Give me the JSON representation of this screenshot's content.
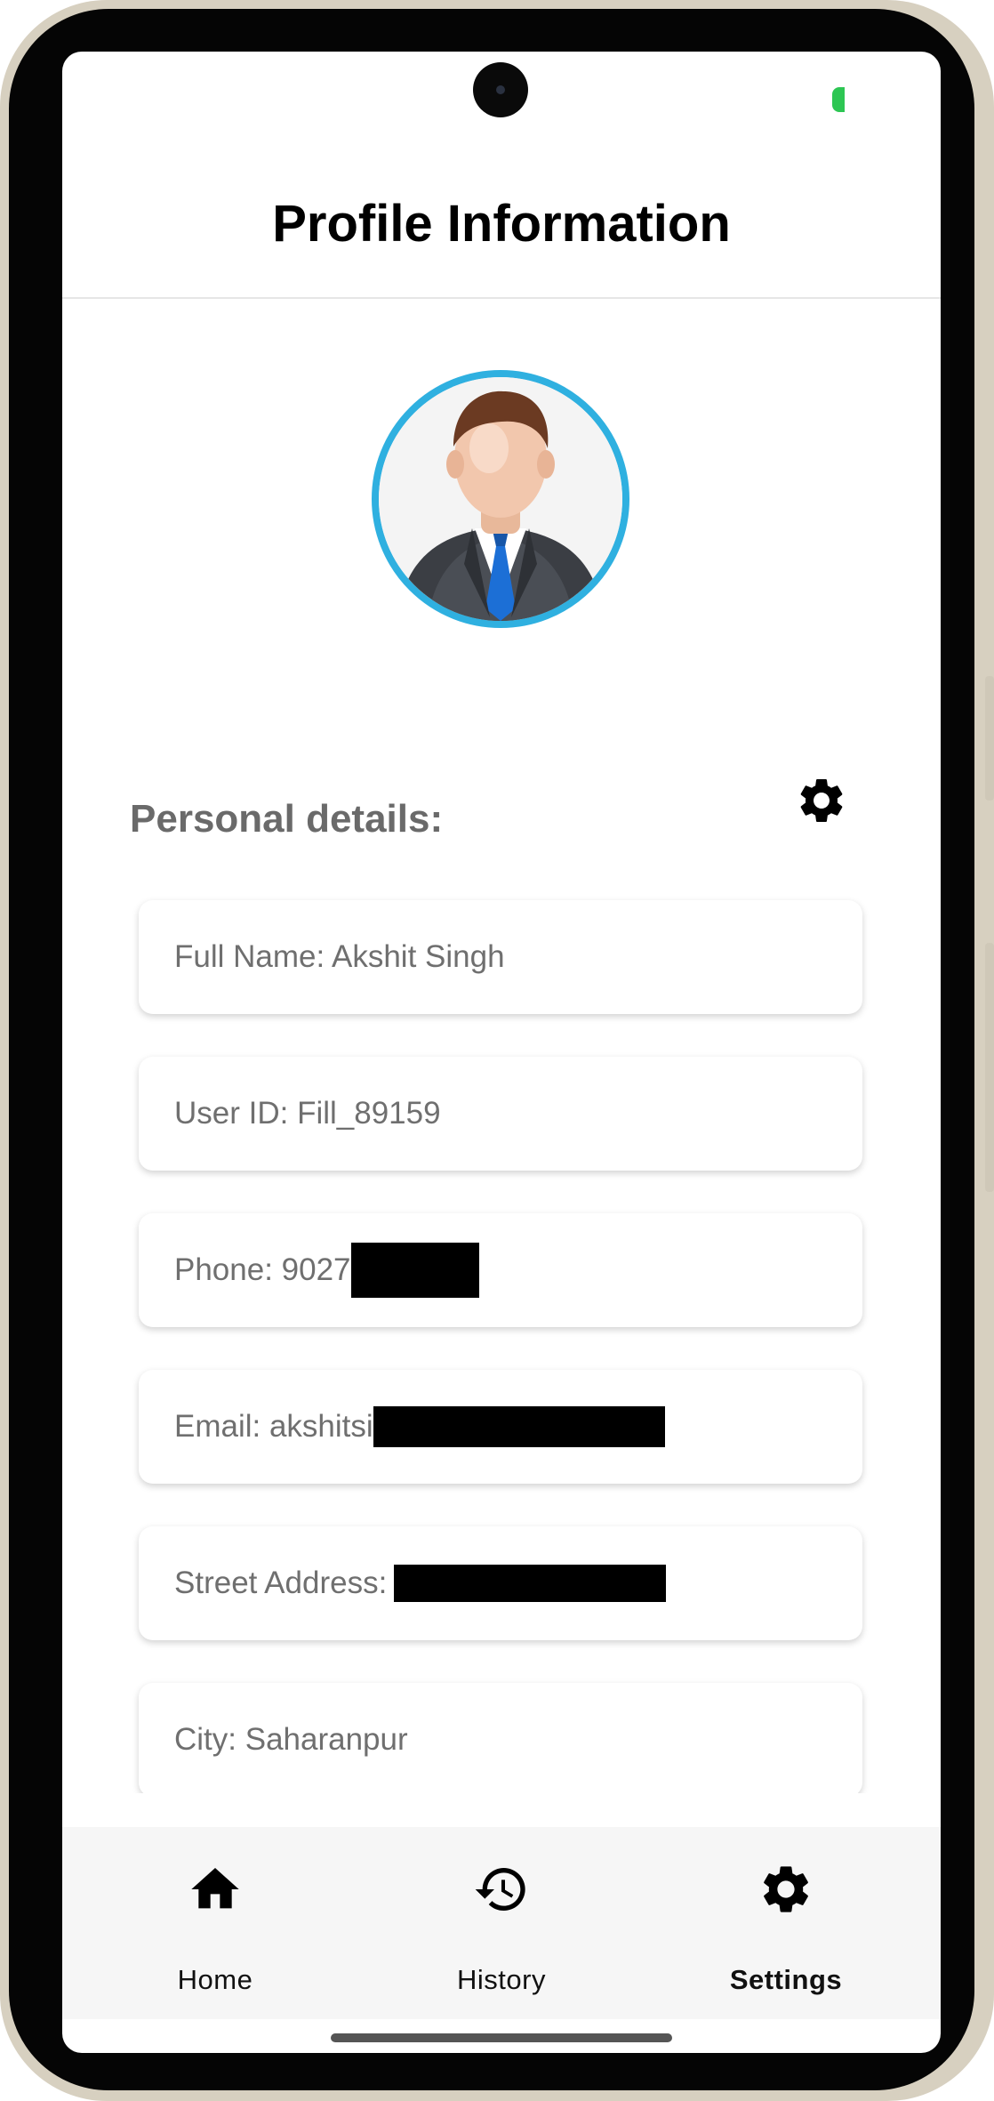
{
  "header": {
    "title": "Profile Information"
  },
  "profile": {
    "avatar_icon": "businessman-avatar-icon"
  },
  "section": {
    "title": "Personal details:",
    "settings_icon": "gear-icon"
  },
  "details": [
    {
      "text": "Full Name: Akshit Singh",
      "redacted": false
    },
    {
      "text": "User ID: Fill_89159",
      "redacted": false
    },
    {
      "text": "Phone: 9027",
      "redacted": true
    },
    {
      "text": "Email: akshitsi",
      "redacted": true
    },
    {
      "text": "Street Address: ",
      "redacted": true
    },
    {
      "text": "City: Saharanpur",
      "redacted": false
    }
  ],
  "nav": {
    "items": [
      {
        "label": "Home",
        "icon": "home-icon",
        "active": false
      },
      {
        "label": "History",
        "icon": "history-icon",
        "active": false
      },
      {
        "label": "Settings",
        "icon": "gear-icon",
        "active": true
      }
    ]
  },
  "colors": {
    "avatar_ring": "#2fb0e0",
    "status_green": "#2dc653",
    "nav_bg": "#f6f6f6",
    "card_text": "#6f6f6f"
  }
}
